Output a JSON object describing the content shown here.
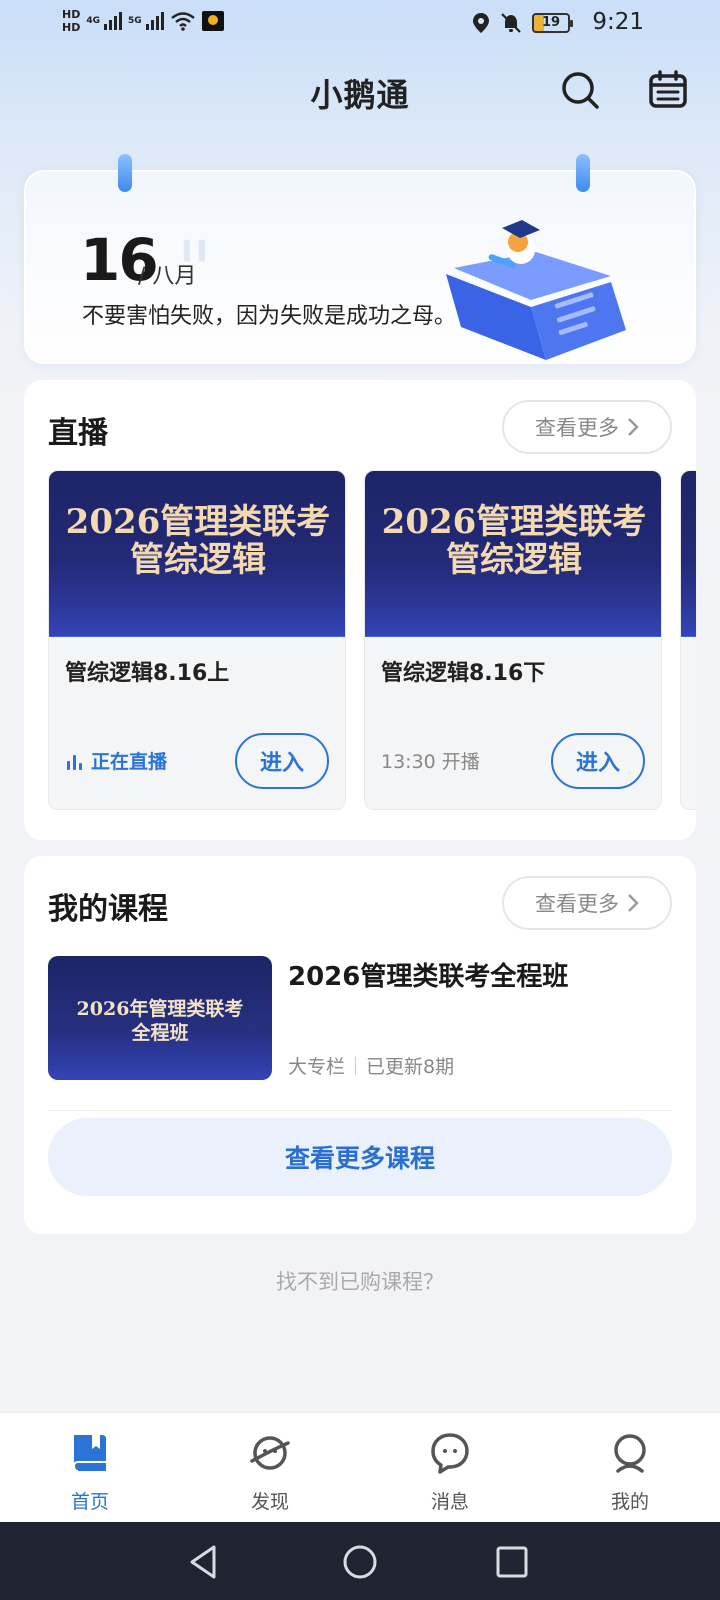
{
  "status_bar": {
    "hd1": "HD",
    "hd2": "HD",
    "net1": "4G",
    "net2": "5G",
    "battery": "19",
    "time": "9:21"
  },
  "header": {
    "title": "小鹅通",
    "icons": [
      "search-icon",
      "calendar-icon"
    ]
  },
  "banner": {
    "day": "16",
    "month": "/ 八月",
    "quote": "不要害怕失败，因为失败是成功之母。"
  },
  "live": {
    "title": "直播",
    "more_label": "查看更多",
    "items": [
      {
        "thumb_line1": "2026管理类联考",
        "thumb_line2": "管综逻辑",
        "name": "管综逻辑8.16上",
        "status": "正在直播",
        "enter_label": "进入"
      },
      {
        "thumb_line1": "2026管理类联考",
        "thumb_line2": "管综逻辑",
        "name": "管综逻辑8.16下",
        "status": "13:30 开播",
        "enter_label": "进入"
      }
    ]
  },
  "courses": {
    "title": "我的课程",
    "more_label": "查看更多",
    "item": {
      "thumb_line1": "2026年管理类联考",
      "thumb_line2": "全程班",
      "title": "2026管理类联考全程班",
      "type": "大专栏",
      "updates": "已更新8期"
    },
    "more_courses_label": "查看更多课程"
  },
  "not_found_label": "找不到已购课程？",
  "tabs": [
    {
      "label": "首页",
      "icon": "home-book-icon",
      "active": true
    },
    {
      "label": "发现",
      "icon": "planet-icon",
      "active": false
    },
    {
      "label": "消息",
      "icon": "chat-icon",
      "active": false
    },
    {
      "label": "我的",
      "icon": "profile-icon",
      "active": false
    }
  ],
  "colors": {
    "accent": "#2a74d8",
    "thumb_navy": "#1d2466",
    "thumb_gold": "#f3d9b0"
  }
}
